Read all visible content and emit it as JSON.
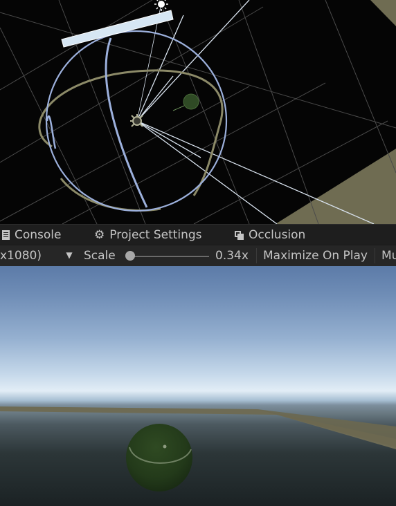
{
  "tabs": [
    {
      "label": "Console",
      "icon": "console-icon"
    },
    {
      "label": "Project Settings",
      "icon": "gear-icon"
    },
    {
      "label": "Occlusion",
      "icon": "occlusion-icon"
    }
  ],
  "toolbar": {
    "resolution_label": "x1080)",
    "scale_label": "Scale",
    "scale_value": "0.34x",
    "scale_level": 0.0,
    "maximize_label": "Maximize On Play",
    "mute_label": "Mu"
  },
  "colors": {
    "scene_background": "#050505",
    "panel_background": "#262626",
    "sphere_green": "#2f4a25",
    "gizmo_blue": "#9cb0dc",
    "gizmo_olive": "#8c8a68"
  },
  "icons": [
    "sun-icon",
    "light-gizmo-icon",
    "dropdown-arrow-icon"
  ]
}
